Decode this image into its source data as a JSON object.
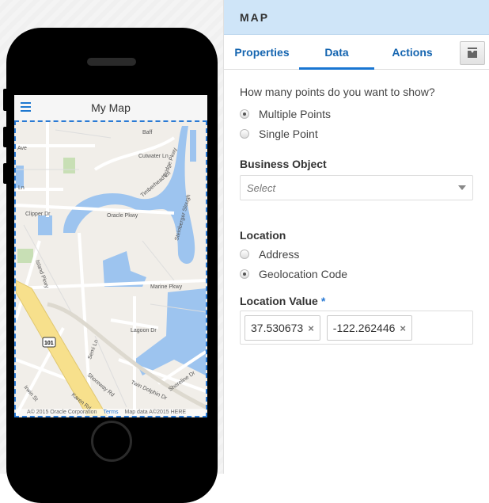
{
  "phone": {
    "title": "My Map",
    "menu_icon": "hamburger-icon",
    "map": {
      "streets": [
        "Ave",
        "Baff",
        "Cutwater Ln",
        "Bridge Pkwy",
        "Timberhead Ln",
        "Steinberger Slough",
        "Clipper Dr",
        "Oracle Pkwy",
        "Island Pkwy",
        "Marine Pkwy",
        "Lagoon Dr",
        "Semi Ln",
        "Shoreway Rd",
        "Twin Dolphin Dr",
        "Shoreline Dr",
        "Irwin St",
        "Karen Rd",
        "Ln"
      ],
      "highway_shield": "101",
      "attribution": {
        "copyright": "A© 2015 Oracle Corporation",
        "terms": "Terms",
        "map_data": "Map data A©2015 HERE"
      },
      "colors": {
        "land": "#f1eee9",
        "water": "#9dc4ef",
        "freeway": "#f7e08c",
        "park": "#c8dfb5"
      }
    }
  },
  "panel": {
    "title": "MAP",
    "tabs": [
      {
        "label": "Properties",
        "active": false
      },
      {
        "label": "Data",
        "active": true
      },
      {
        "label": "Actions",
        "active": false
      }
    ],
    "question": "How many points do you want to show?",
    "points_options": [
      {
        "label": "Multiple Points",
        "selected": true
      },
      {
        "label": "Single Point",
        "selected": false
      }
    ],
    "business_object": {
      "label": "Business Object",
      "placeholder": "Select"
    },
    "location": {
      "label": "Location",
      "options": [
        {
          "label": "Address",
          "selected": false
        },
        {
          "label": "Geolocation Code",
          "selected": true
        }
      ]
    },
    "location_value": {
      "label": "Location Value",
      "required_mark": "*",
      "chips": [
        "37.530673",
        "-122.262446"
      ],
      "remove_icon": "×"
    },
    "accent": "#1976d2"
  }
}
